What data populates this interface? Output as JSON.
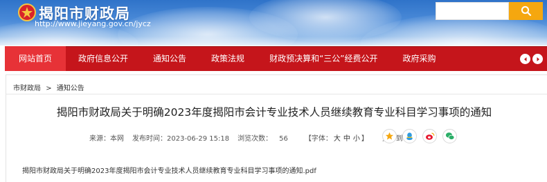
{
  "header": {
    "site_title": "揭阳市财政局",
    "site_url": "http://www.jieyang.gov.cn/jycz",
    "search": {
      "placeholder": ""
    },
    "colors": {
      "banner": "#3f81d2",
      "search_button": "#f5a70f"
    }
  },
  "nav": {
    "colors": {
      "bar": "#c5151b",
      "active": "#e73237"
    },
    "items": [
      {
        "label": "网站首页",
        "active": true
      },
      {
        "label": "政府信息公开"
      },
      {
        "label": "通知公告"
      },
      {
        "label": "政策法规"
      },
      {
        "label": "财政预决算和“三公”经费公开"
      },
      {
        "label": "政府采购"
      }
    ]
  },
  "breadcrumb": {
    "items": [
      "市财政局",
      "通知公告"
    ],
    "separator": ">"
  },
  "article": {
    "title": "揭阳市财政局关于明确2023年度揭阳市会计专业技术人员继续教育专业科目学习事项的通知",
    "source": "来源：本网",
    "published": "发布时间：2023-06-29 15:18",
    "views_label": "浏览次数：",
    "views": "56",
    "font_size_prefix": "【字体：",
    "font_sizes": [
      "大",
      "中",
      "小"
    ],
    "font_size_suffix": "】",
    "share_label": "分享到：",
    "share_icons": [
      "star-icon",
      "qq-zone-icon",
      "weibo-icon",
      "wechat-icon"
    ],
    "attachment": "揭阳市财政局关于明确2023年度揭阳市会计专业技术人员继续教育专业科目学习事项的通知.pdf"
  }
}
